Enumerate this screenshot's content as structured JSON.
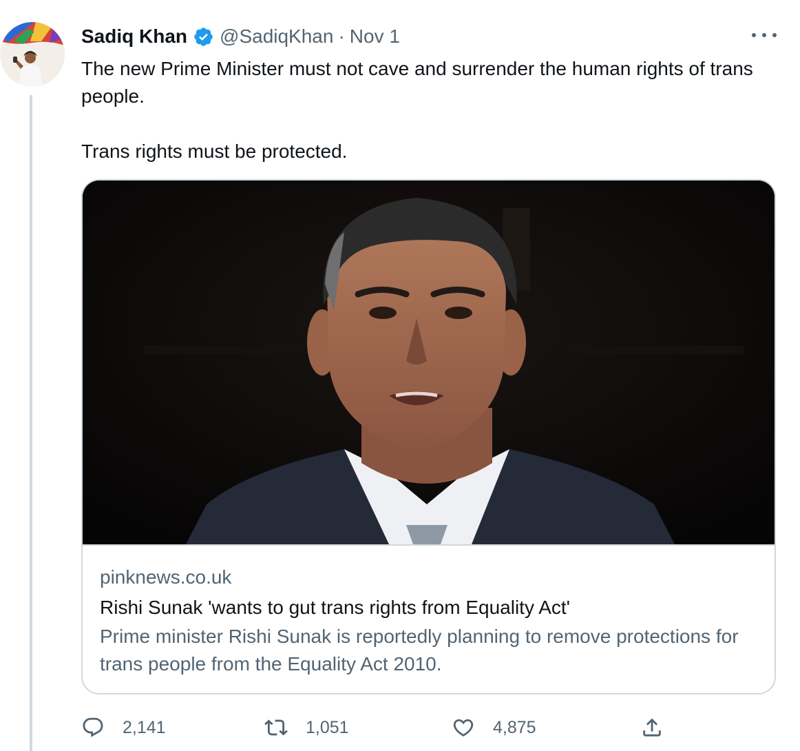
{
  "tweet": {
    "author": {
      "display_name": "Sadiq Khan",
      "handle": "@SadiqKhan",
      "verified": true,
      "avatar_icon": "profile-photo"
    },
    "separator": "·",
    "timestamp": "Nov 1",
    "more_icon": "ellipsis-icon",
    "text_paragraphs": [
      "The new Prime Minister must not cave and surrender the human rights of trans people.",
      "Trans rights must be protected."
    ],
    "card": {
      "image_icon": "article-photo",
      "domain": "pinknews.co.uk",
      "title": "Rishi Sunak 'wants to gut trans rights from Equality Act'",
      "description": "Prime minister Rishi Sunak is reportedly planning to remove protections for trans people from the Equality Act 2010."
    },
    "actions": {
      "reply": {
        "icon": "reply-icon",
        "count": "2,141"
      },
      "retweet": {
        "icon": "retweet-icon",
        "count": "1,051"
      },
      "like": {
        "icon": "like-icon",
        "count": "4,875"
      },
      "share": {
        "icon": "share-icon"
      }
    }
  },
  "colors": {
    "text_primary": "#0f1419",
    "text_secondary": "#536471",
    "border": "#cfd9de",
    "verified_blue": "#1d9bf0"
  }
}
